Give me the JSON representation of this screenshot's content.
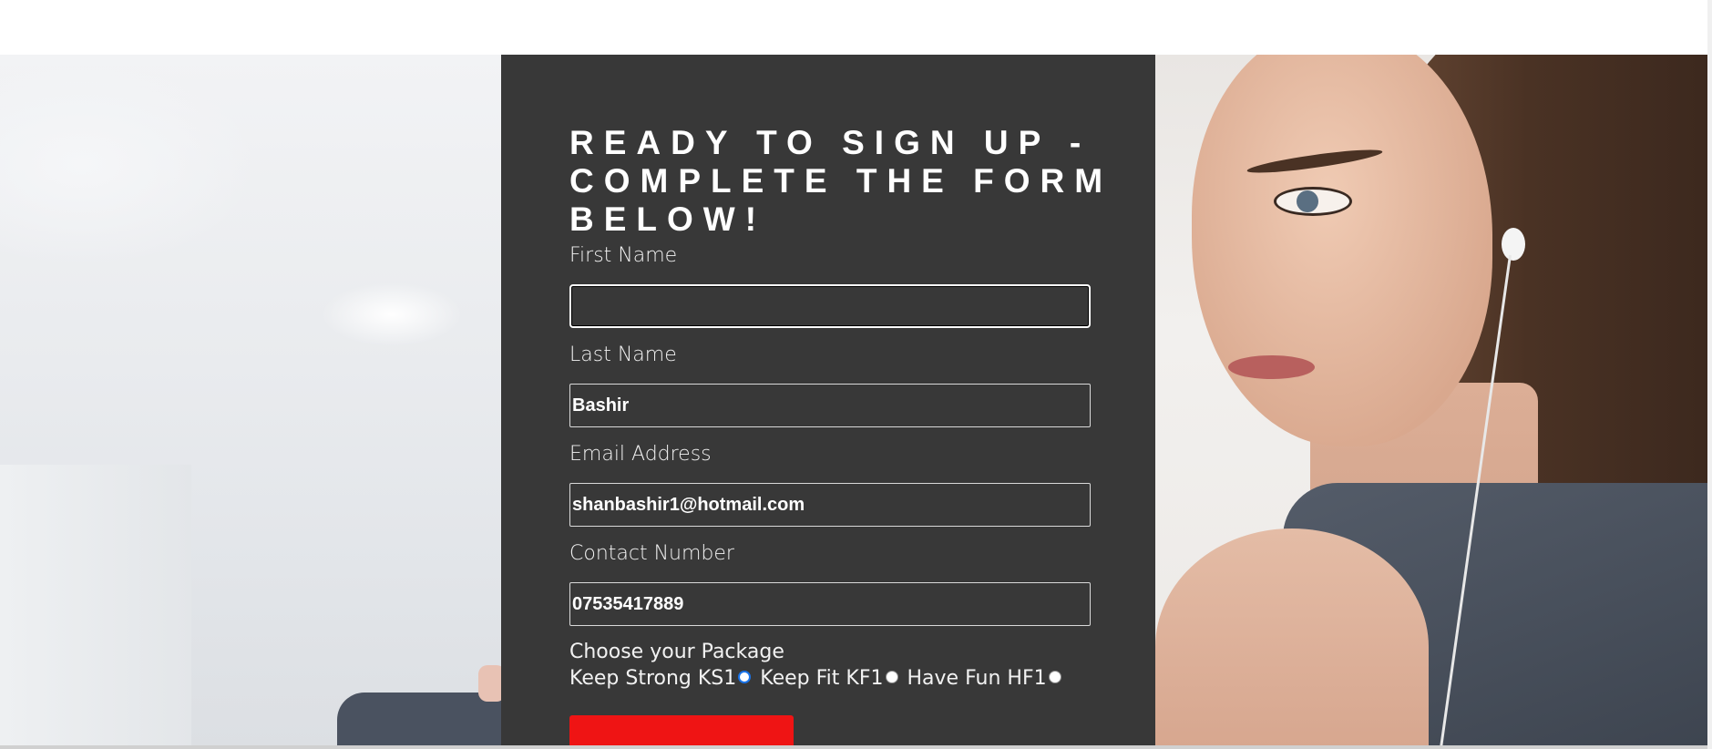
{
  "form": {
    "title": "READY TO SIGN UP - COMPLETE THE FORM BELOW!",
    "first_name": {
      "label": "First Name",
      "value": ""
    },
    "last_name": {
      "label": "Last Name",
      "value": "Bashir"
    },
    "email": {
      "label": "Email Address",
      "value": "shanbashir1@hotmail.com"
    },
    "contact": {
      "label": "Contact Number",
      "value": "07535417889"
    },
    "package": {
      "label": "Choose your Package",
      "options": [
        {
          "label": "Keep Strong KS1",
          "checked": true
        },
        {
          "label": "Keep Fit KF1",
          "checked": false
        },
        {
          "label": "Have Fun HF1",
          "checked": false
        }
      ]
    },
    "submit_label": ""
  },
  "colors": {
    "panel": "#383838",
    "accent": "#ef1414",
    "text": "#ffffff"
  }
}
